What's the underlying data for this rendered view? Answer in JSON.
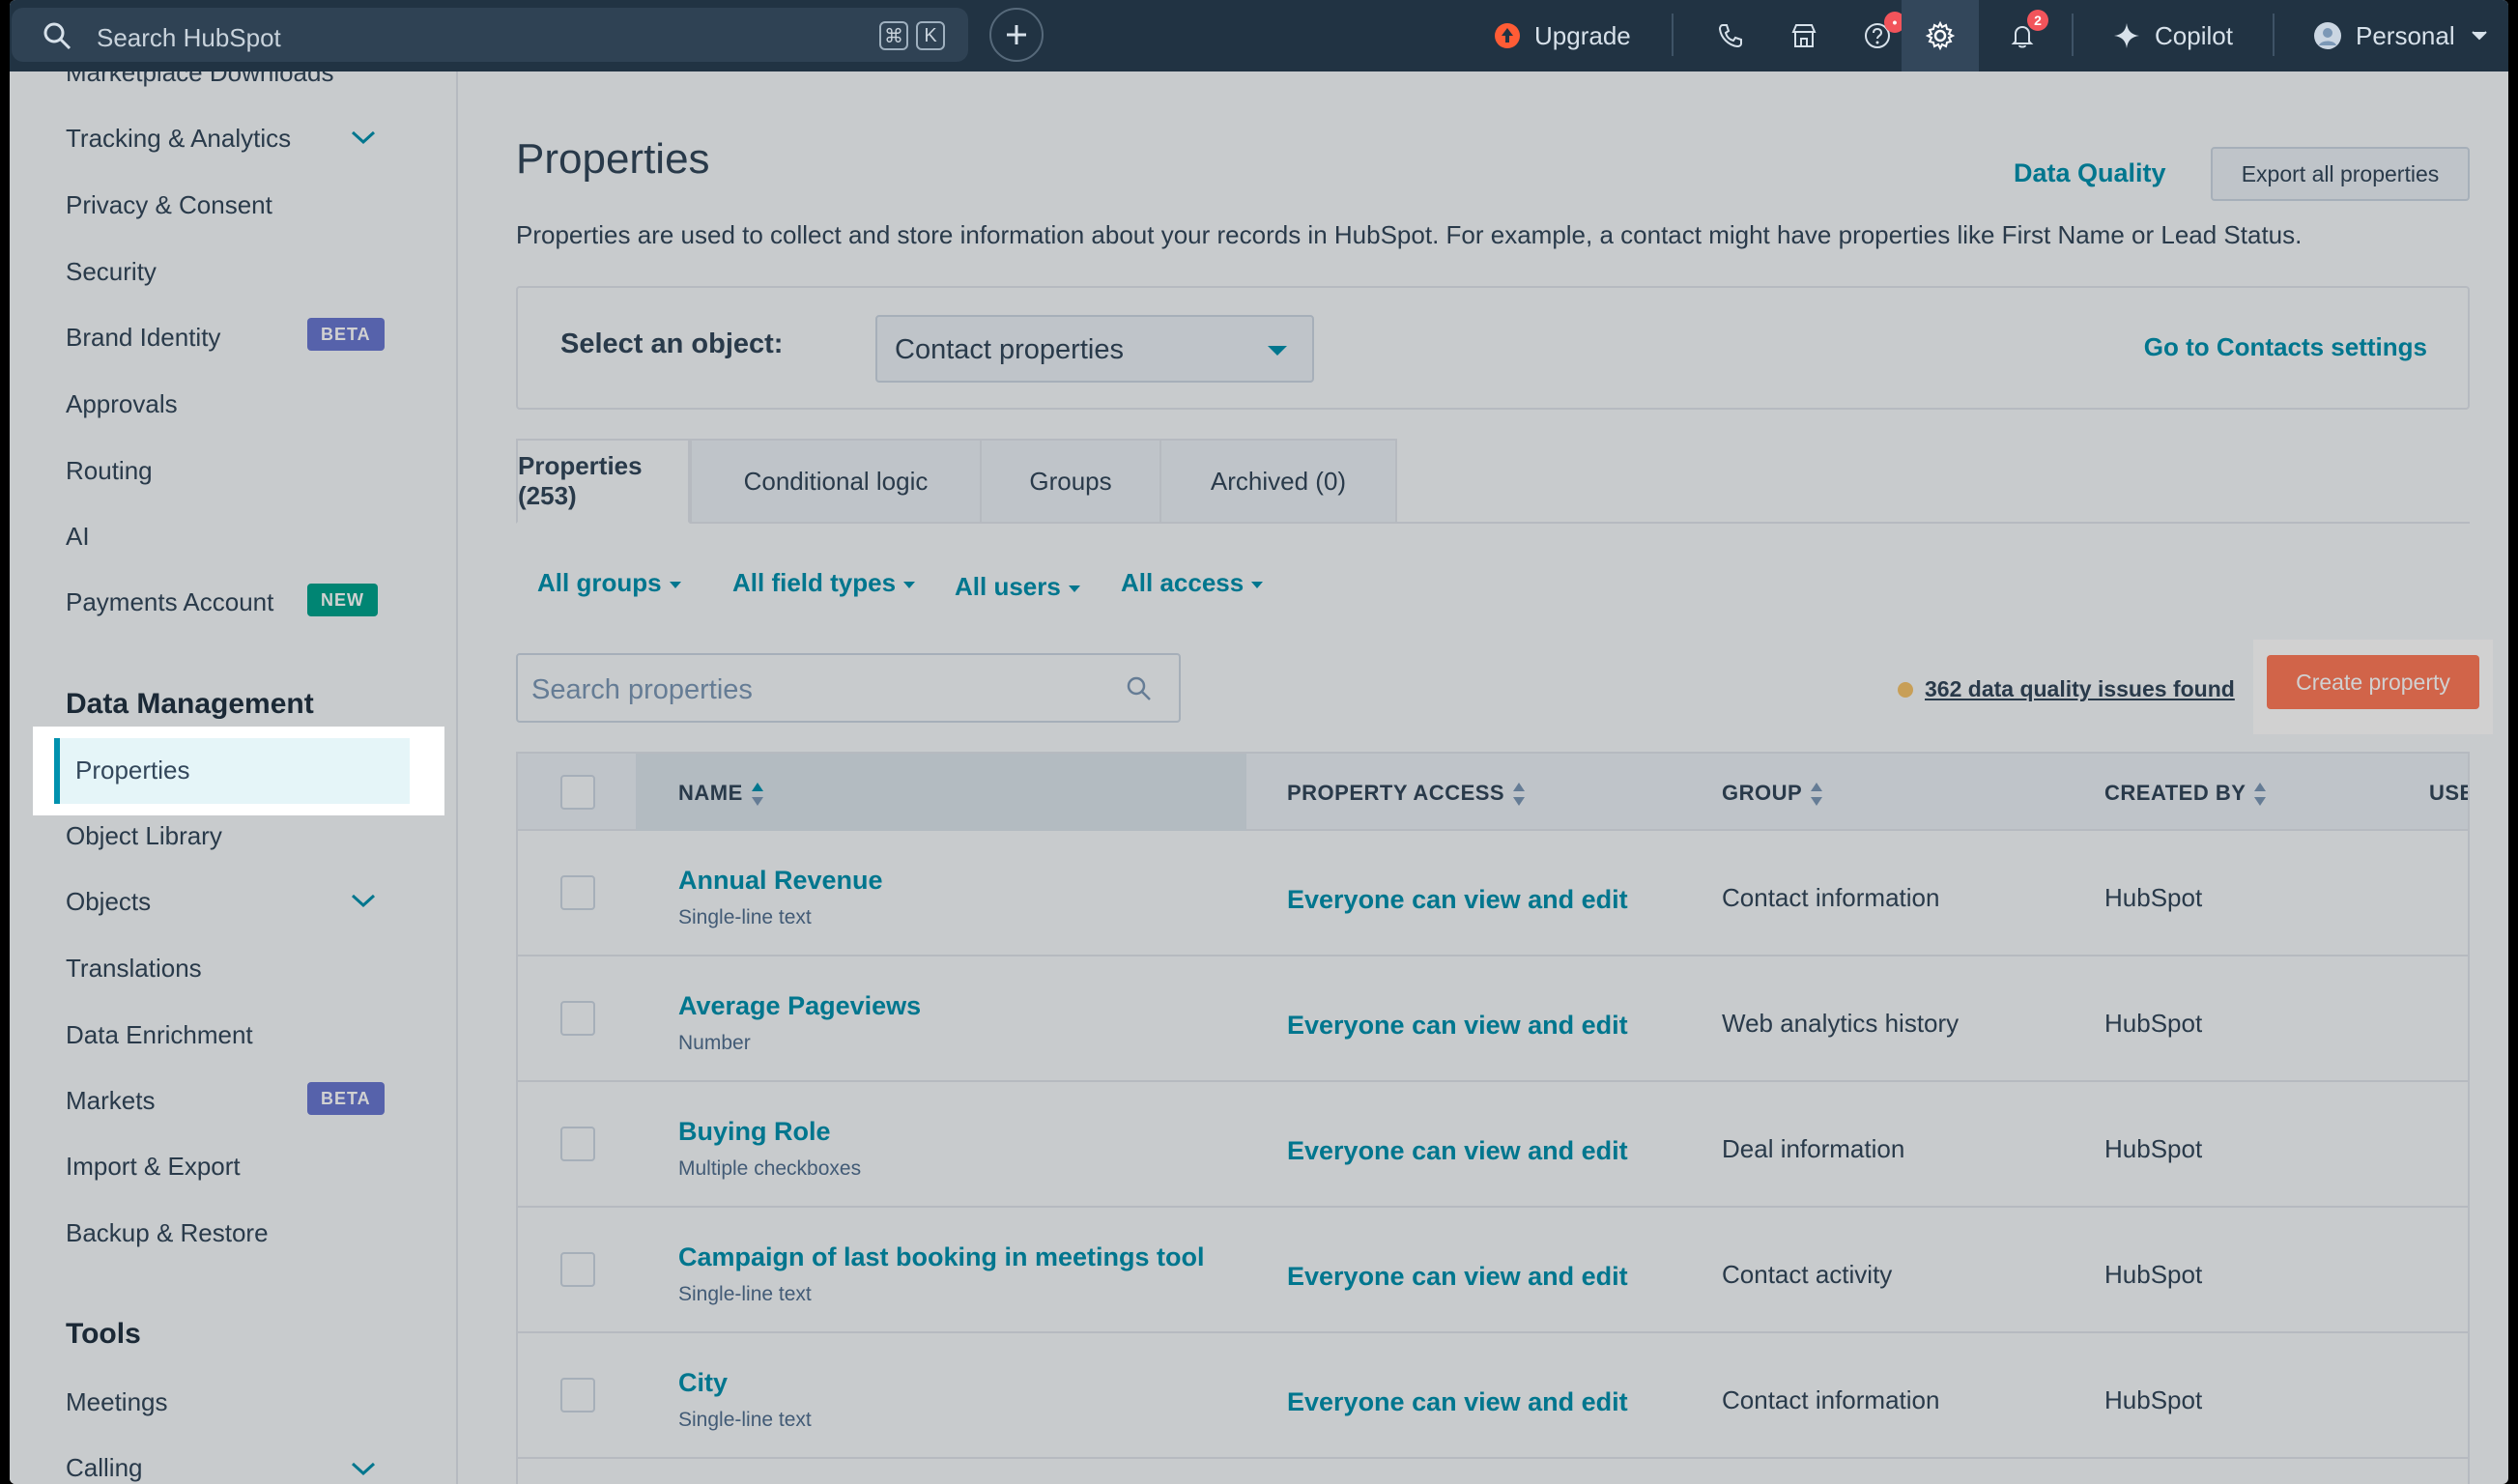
{
  "topbar": {
    "search_placeholder": "Search HubSpot",
    "kbd_cmd": "⌘",
    "kbd_k": "K",
    "upgrade": "Upgrade",
    "help_badge": "•",
    "notif_badge": "2",
    "copilot": "Copilot",
    "account": "Personal"
  },
  "sidebar": {
    "cut_top": "Marketplace Downloads",
    "items": [
      {
        "label": "Tracking & Analytics"
      },
      {
        "label": "Privacy & Consent"
      },
      {
        "label": "Security"
      },
      {
        "label": "Brand Identity",
        "tag": "BETA"
      },
      {
        "label": "Approvals"
      },
      {
        "label": "Routing"
      },
      {
        "label": "AI"
      },
      {
        "label": "Payments Account",
        "tag": "NEW"
      }
    ],
    "section_data": "Data Management",
    "data_items": [
      {
        "label": "Properties"
      },
      {
        "label": "Object Library"
      },
      {
        "label": "Objects"
      },
      {
        "label": "Translations"
      },
      {
        "label": "Data Enrichment"
      },
      {
        "label": "Markets",
        "tag": "BETA"
      },
      {
        "label": "Import & Export"
      },
      {
        "label": "Backup & Restore"
      }
    ],
    "section_tools": "Tools",
    "tools_items": [
      {
        "label": "Meetings"
      },
      {
        "label": "Calling"
      }
    ]
  },
  "main": {
    "title": "Properties",
    "data_quality": "Data Quality",
    "export": "Export all properties",
    "description": "Properties are used to collect and store information about your records in HubSpot. For example, a contact might have properties like First Name or Lead Status.",
    "select_label": "Select an object:",
    "select_value": "Contact properties",
    "go_settings": "Go to Contacts settings",
    "tabs": [
      "Properties (253)",
      "Conditional logic",
      "Groups",
      "Archived (0)"
    ],
    "filters": [
      "All groups",
      "All field types",
      "All users",
      "All access"
    ],
    "search_placeholder": "Search properties",
    "dq_issues": "362 data quality issues found",
    "create": "Create property"
  },
  "table": {
    "columns": [
      "NAME",
      "PROPERTY ACCESS",
      "GROUP",
      "CREATED BY",
      "USE"
    ],
    "rows": [
      {
        "name": "Annual Revenue",
        "type": "Single-line text",
        "access": "Everyone can view and edit",
        "group": "Contact information",
        "by": "HubSpot"
      },
      {
        "name": "Average Pageviews",
        "type": "Number",
        "access": "Everyone can view and edit",
        "group": "Web analytics history",
        "by": "HubSpot"
      },
      {
        "name": "Buying Role",
        "type": "Multiple checkboxes",
        "access": "Everyone can view and edit",
        "group": "Deal information",
        "by": "HubSpot"
      },
      {
        "name": "Campaign of last booking in meetings tool",
        "type": "Single-line text",
        "access": "Everyone can view and edit",
        "group": "Contact activity",
        "by": "HubSpot"
      },
      {
        "name": "City",
        "type": "Single-line text",
        "access": "Everyone can view and edit",
        "group": "Contact information",
        "by": "HubSpot"
      }
    ]
  },
  "colors": {
    "accent": "#0091ae",
    "cta": "#ff7a59",
    "topbar": "#213343",
    "beta": "#6a78d1",
    "new": "#00a38d"
  }
}
